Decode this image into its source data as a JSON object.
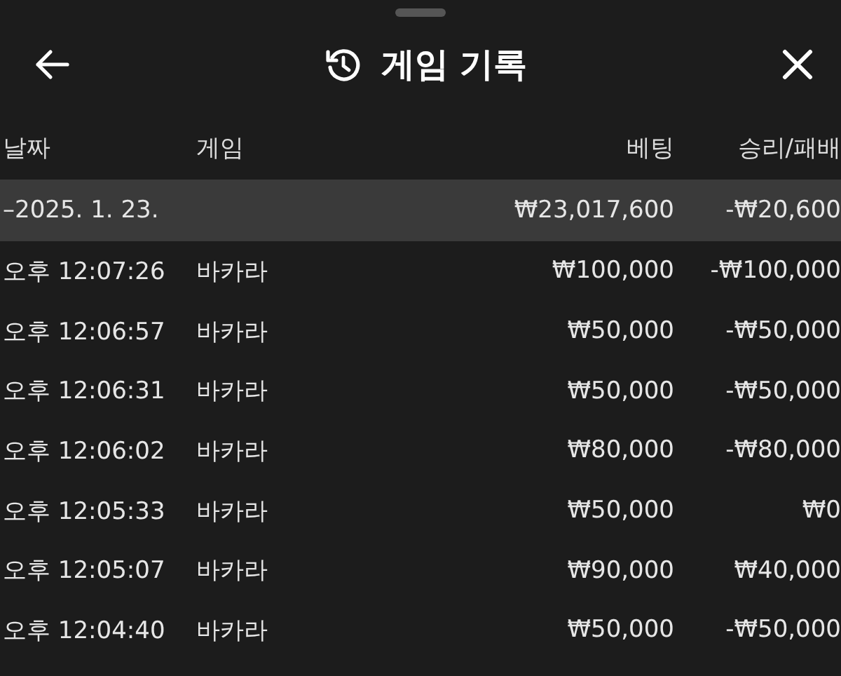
{
  "header": {
    "title": "게임 기록"
  },
  "table": {
    "columns": [
      "날짜",
      "게임",
      "베팅",
      "승리/패배"
    ],
    "group": {
      "date": "–2025. 1. 23.",
      "bet": "₩23,017,600",
      "result": "-₩20,600"
    },
    "rows": [
      {
        "time": "오후 12:07:26",
        "game": "바카라",
        "bet": "₩100,000",
        "result": "-₩100,000"
      },
      {
        "time": "오후 12:06:57",
        "game": "바카라",
        "bet": "₩50,000",
        "result": "-₩50,000"
      },
      {
        "time": "오후 12:06:31",
        "game": "바카라",
        "bet": "₩50,000",
        "result": "-₩50,000"
      },
      {
        "time": "오후 12:06:02",
        "game": "바카라",
        "bet": "₩80,000",
        "result": "-₩80,000"
      },
      {
        "time": "오후 12:05:33",
        "game": "바카라",
        "bet": "₩50,000",
        "result": "₩0"
      },
      {
        "time": "오후 12:05:07",
        "game": "바카라",
        "bet": "₩90,000",
        "result": "₩40,000"
      },
      {
        "time": "오후 12:04:40",
        "game": "바카라",
        "bet": "₩50,000",
        "result": "-₩50,000"
      }
    ]
  }
}
